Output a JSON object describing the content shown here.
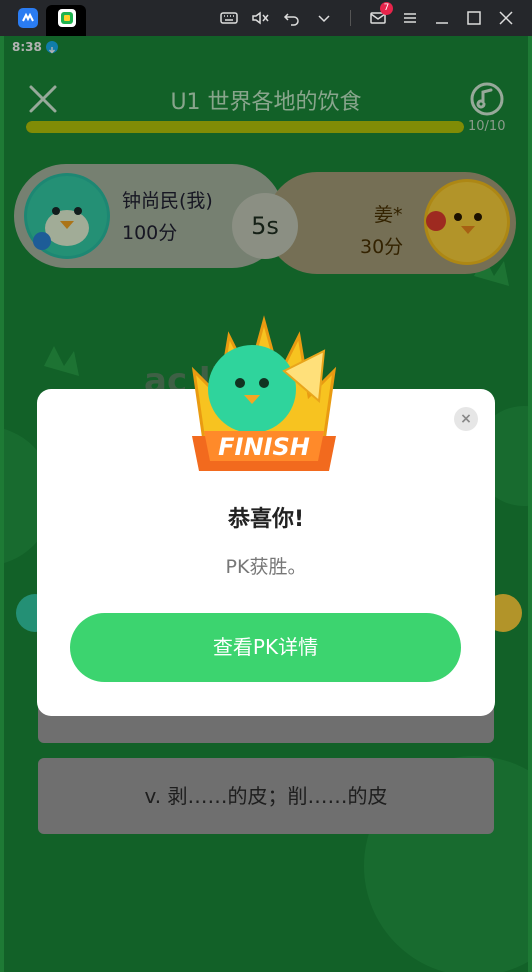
{
  "window": {
    "mail_count": "7"
  },
  "status_bar": {
    "time": "8:38"
  },
  "header": {
    "title": "U1 世界各地的饮食",
    "progress_text": "10/10",
    "progress_fraction": 1.0
  },
  "pk": {
    "left_name": "钟尚民(我)",
    "left_score": "100分",
    "timer": "5s",
    "right_name": "姜*",
    "right_score": "30分"
  },
  "question": {
    "word_partial": "ac        lly"
  },
  "answers": [
    {
      "text": "v. 剥……的皮；削……的皮"
    }
  ],
  "modal": {
    "badge_text": "FINISH",
    "close_label": "×",
    "title": "恭喜你!",
    "message": "PK获胜。",
    "button_label": "查看PK详情"
  },
  "colors": {
    "accent": "#3cd46f",
    "page_bg": "#1a8b3a",
    "progress": "#b8c90a"
  }
}
